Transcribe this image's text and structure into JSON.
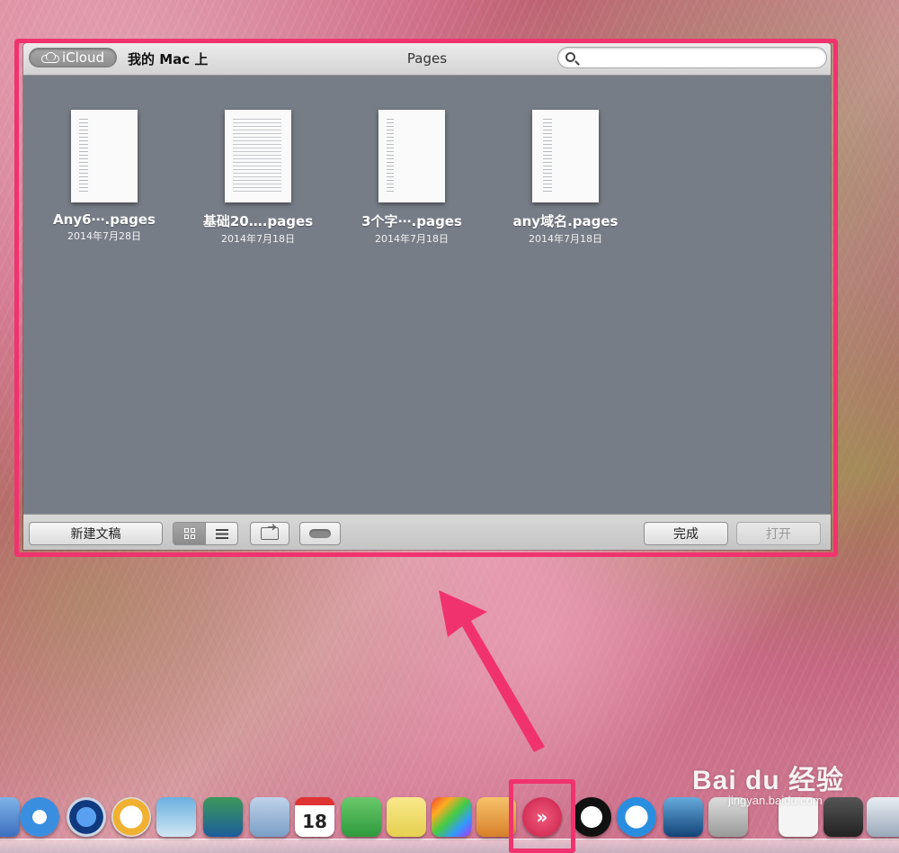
{
  "window": {
    "icloud_label": "iCloud",
    "mac_tab_label": "我的 Mac 上",
    "title": "Pages",
    "search_placeholder": ""
  },
  "documents": [
    {
      "name": "Any6⋯.pages",
      "date": "2014年7月28日"
    },
    {
      "name": "基础20….pages",
      "date": "2014年7月18日"
    },
    {
      "name": "3个字⋯.pages",
      "date": "2014年7月18日"
    },
    {
      "name": "any域名.pages",
      "date": "2014年7月18日"
    }
  ],
  "toolbar": {
    "new_doc_label": "新建文稿",
    "done_label": "完成",
    "open_label": "打开"
  },
  "dock": {
    "calendar_day": "18",
    "apps": [
      "finder-icon",
      "safari-icon",
      "quicktime-icon",
      "itunes-icon",
      "preview-icon",
      "iphoto-icon",
      "mail-icon",
      "calendar-icon",
      "evernote-icon",
      "notes-icon",
      "final-cut-icon",
      "pages-icon",
      "readkit-icon",
      "qq-icon",
      "weibo-icon",
      "xcode-icon",
      "photo-app-icon",
      "document-icon",
      "screen-icon",
      "finder-window-icon"
    ]
  },
  "watermark": {
    "main": "Bai du 经验",
    "sub": "jingyan.baidu.com"
  },
  "colors": {
    "highlight": "#f0336f",
    "window_content": "#777d87"
  }
}
